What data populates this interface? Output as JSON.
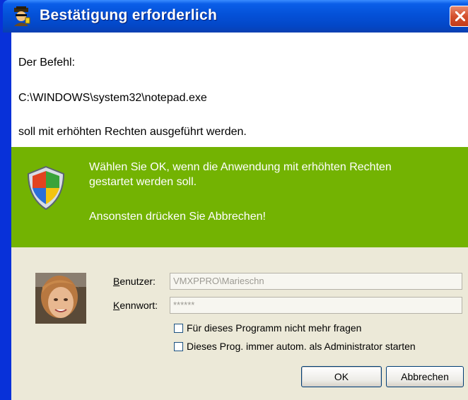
{
  "window": {
    "title": "Bestätigung erforderlich",
    "close_icon": "close-icon"
  },
  "message": {
    "line1": "Der Befehl:",
    "command": "C:\\WINDOWS\\system32\\notepad.exe",
    "line3": "soll mit erhöhten Rechten ausgeführt werden."
  },
  "banner": {
    "icon": "shield-icon",
    "line1": "Wählen Sie OK, wenn die Anwendung mit erhöhten Rechten",
    "line2": "gestartet werden soll.",
    "line3": "Ansonsten drücken Sie Abbrechen!",
    "color": "#73b302"
  },
  "form": {
    "user_label_accel": "B",
    "user_label_rest": "enutzer:",
    "user_value": "VMXPPRO\\Marieschn",
    "password_label_accel": "K",
    "password_label_rest": "ennwort:",
    "password_value": "******",
    "checkbox1_label": "Für dieses Programm nicht mehr fragen",
    "checkbox2_label": "Dieses Prog. immer autom. als Administrator starten"
  },
  "buttons": {
    "ok": "OK",
    "cancel": "Abbrechen"
  }
}
